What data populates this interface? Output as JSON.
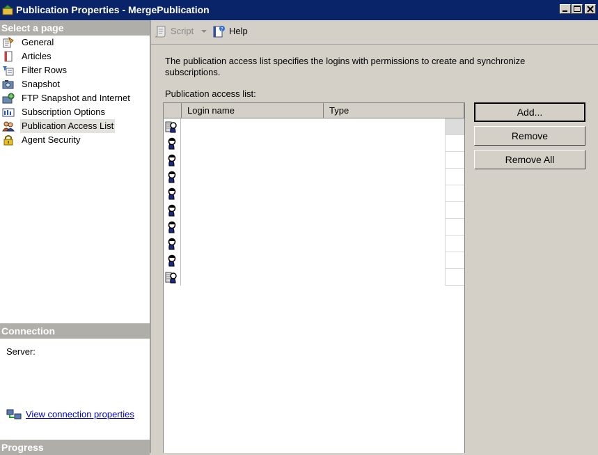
{
  "window": {
    "title": "Publication Properties - MergePublication"
  },
  "sidebar": {
    "header": "Select a page",
    "items": [
      {
        "label": "General",
        "icon": "general-page-icon"
      },
      {
        "label": "Articles",
        "icon": "articles-page-icon"
      },
      {
        "label": "Filter Rows",
        "icon": "filter-rows-icon"
      },
      {
        "label": "Snapshot",
        "icon": "snapshot-icon"
      },
      {
        "label": "FTP Snapshot and Internet",
        "icon": "ftp-icon"
      },
      {
        "label": "Subscription Options",
        "icon": "subscription-options-icon"
      },
      {
        "label": "Publication Access List",
        "icon": "users-icon",
        "selected": true
      },
      {
        "label": "Agent Security",
        "icon": "lock-icon"
      }
    ]
  },
  "connection": {
    "header": "Connection",
    "server_label": "Server:",
    "link_label": "View connection properties"
  },
  "progress": {
    "header": "Progress"
  },
  "toolbar": {
    "script_label": "Script",
    "help_label": "Help"
  },
  "main": {
    "description": "The publication access list specifies the logins with permissions to create and synchronize subscriptions.",
    "list_label": "Publication access list:",
    "columns": [
      "Login name",
      "Type"
    ],
    "rows": [
      {
        "icon": "group-user-icon"
      },
      {
        "icon": "user-icon"
      },
      {
        "icon": "user-icon"
      },
      {
        "icon": "user-icon"
      },
      {
        "icon": "user-icon"
      },
      {
        "icon": "user-icon"
      },
      {
        "icon": "user-icon"
      },
      {
        "icon": "user-icon"
      },
      {
        "icon": "user-icon"
      },
      {
        "icon": "group-user-icon"
      }
    ]
  },
  "buttons": {
    "add": "Add...",
    "remove": "Remove",
    "remove_all": "Remove All"
  },
  "colors": {
    "titlebar": "#0a246a",
    "section_header": "#b0aea8",
    "link": "#0000cc"
  }
}
